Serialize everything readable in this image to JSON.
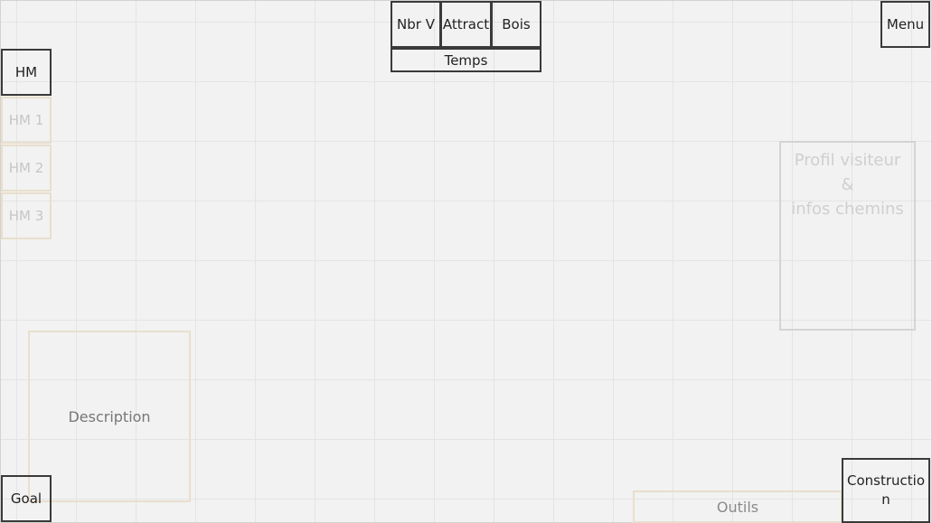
{
  "top_stats": {
    "nbr_v": "Nbr V",
    "attract": "Attract",
    "bois": "Bois",
    "temps": "Temps"
  },
  "menu": {
    "label": "Menu"
  },
  "hm_panel": {
    "main": "HM",
    "items": [
      "HM 1",
      "HM 2",
      "HM 3"
    ]
  },
  "description": {
    "label": "Description"
  },
  "goal": {
    "label": "Goal"
  },
  "profil": {
    "line1": "Profil visiteur",
    "line2": "&",
    "line3": "infos chemins"
  },
  "outils": {
    "label": "Outils"
  },
  "construction": {
    "label": "Construction"
  },
  "colors": {
    "background": "#f2f2f2",
    "active_border": "#3a3a3a",
    "inactive_border": "#e8dfcc",
    "inactive_text": "#c6c6c6"
  }
}
